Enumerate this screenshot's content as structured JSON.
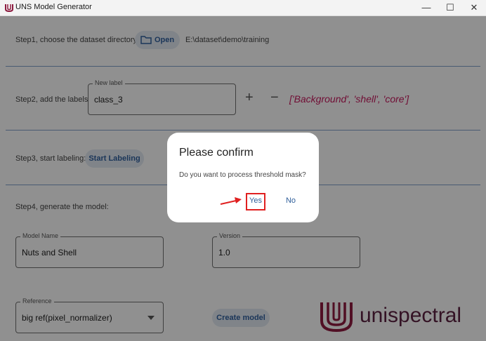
{
  "window": {
    "title": "UNS Model Generator",
    "minimize_glyph": "—",
    "maximize_glyph": "☐",
    "close_glyph": "✕"
  },
  "step1": {
    "label": "Step1, choose the dataset directory:",
    "open_label": "Open",
    "path": "E:\\dataset\\demo\\training"
  },
  "step2": {
    "label": "Step2, add the labels:",
    "field_label": "New label",
    "field_value": "class_3",
    "add_glyph": "+",
    "remove_glyph": "−",
    "labels_list": "['Background', 'shell', 'core']"
  },
  "step3": {
    "label": "Step3, start labeling:",
    "button_label": "Start Labeling"
  },
  "step4": {
    "label": "Step4, generate the model:",
    "model_name_label": "Model Name",
    "model_name_value": "Nuts and Shell",
    "version_label": "Version",
    "version_value": "1.0",
    "reference_label": "Reference",
    "reference_value": "big ref(pixel_normalizer)",
    "create_label": "Create model"
  },
  "logo": {
    "text": "unispectral"
  },
  "dialog": {
    "title": "Please confirm",
    "message": "Do you want to process threshold mask?",
    "yes_label": "Yes",
    "no_label": "No"
  },
  "colors": {
    "accent": "#2f5e9a",
    "labels_text": "#c2185b",
    "logo": "#8c1a3e",
    "annotation": "#e02020"
  },
  "icons": [
    "app-icon",
    "folder-icon",
    "dropdown-arrow-icon",
    "annotation-arrow-icon"
  ]
}
